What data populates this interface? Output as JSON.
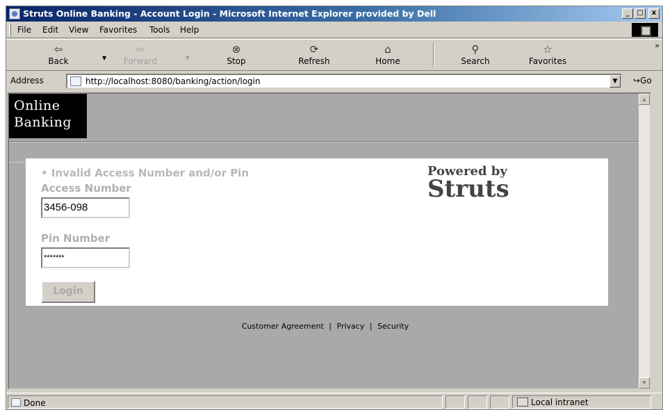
{
  "window": {
    "title": "Struts Online Banking - Account Login - Microsoft Internet Explorer provided by Dell",
    "minimize": "_",
    "maximize": "□",
    "close": "x"
  },
  "menu": [
    "File",
    "Edit",
    "View",
    "Favorites",
    "Tools",
    "Help"
  ],
  "toolbar": {
    "back": "Back",
    "forward": "Forward",
    "stop": "Stop",
    "refresh": "Refresh",
    "home": "Home",
    "search": "Search",
    "favorites": "Favorites",
    "more": "»"
  },
  "address": {
    "label": "Address",
    "url": "http://localhost:8080/banking/action/login",
    "go": "Go"
  },
  "page": {
    "logo_line1": "Online",
    "logo_line2": "Banking",
    "error": "• Invalid Access Number and/or Pin",
    "access_label": "Access Number",
    "access_value": "3456-098",
    "pin_label": "Pin Number",
    "pin_value": "*******",
    "login_button": "Login",
    "powered_by": "Powered by",
    "struts": "Struts",
    "footer": {
      "agreement": "Customer Agreement",
      "sep1": "|",
      "privacy": "Privacy",
      "sep2": "|",
      "security": "Security"
    }
  },
  "status": {
    "text": "Done",
    "zone": "Local intranet"
  },
  "icons": {
    "back": "back-arrow-icon",
    "forward": "forward-arrow-icon",
    "stop": "stop-icon",
    "refresh": "refresh-icon",
    "home": "home-icon",
    "search": "search-icon",
    "favorites": "favorites-icon"
  }
}
